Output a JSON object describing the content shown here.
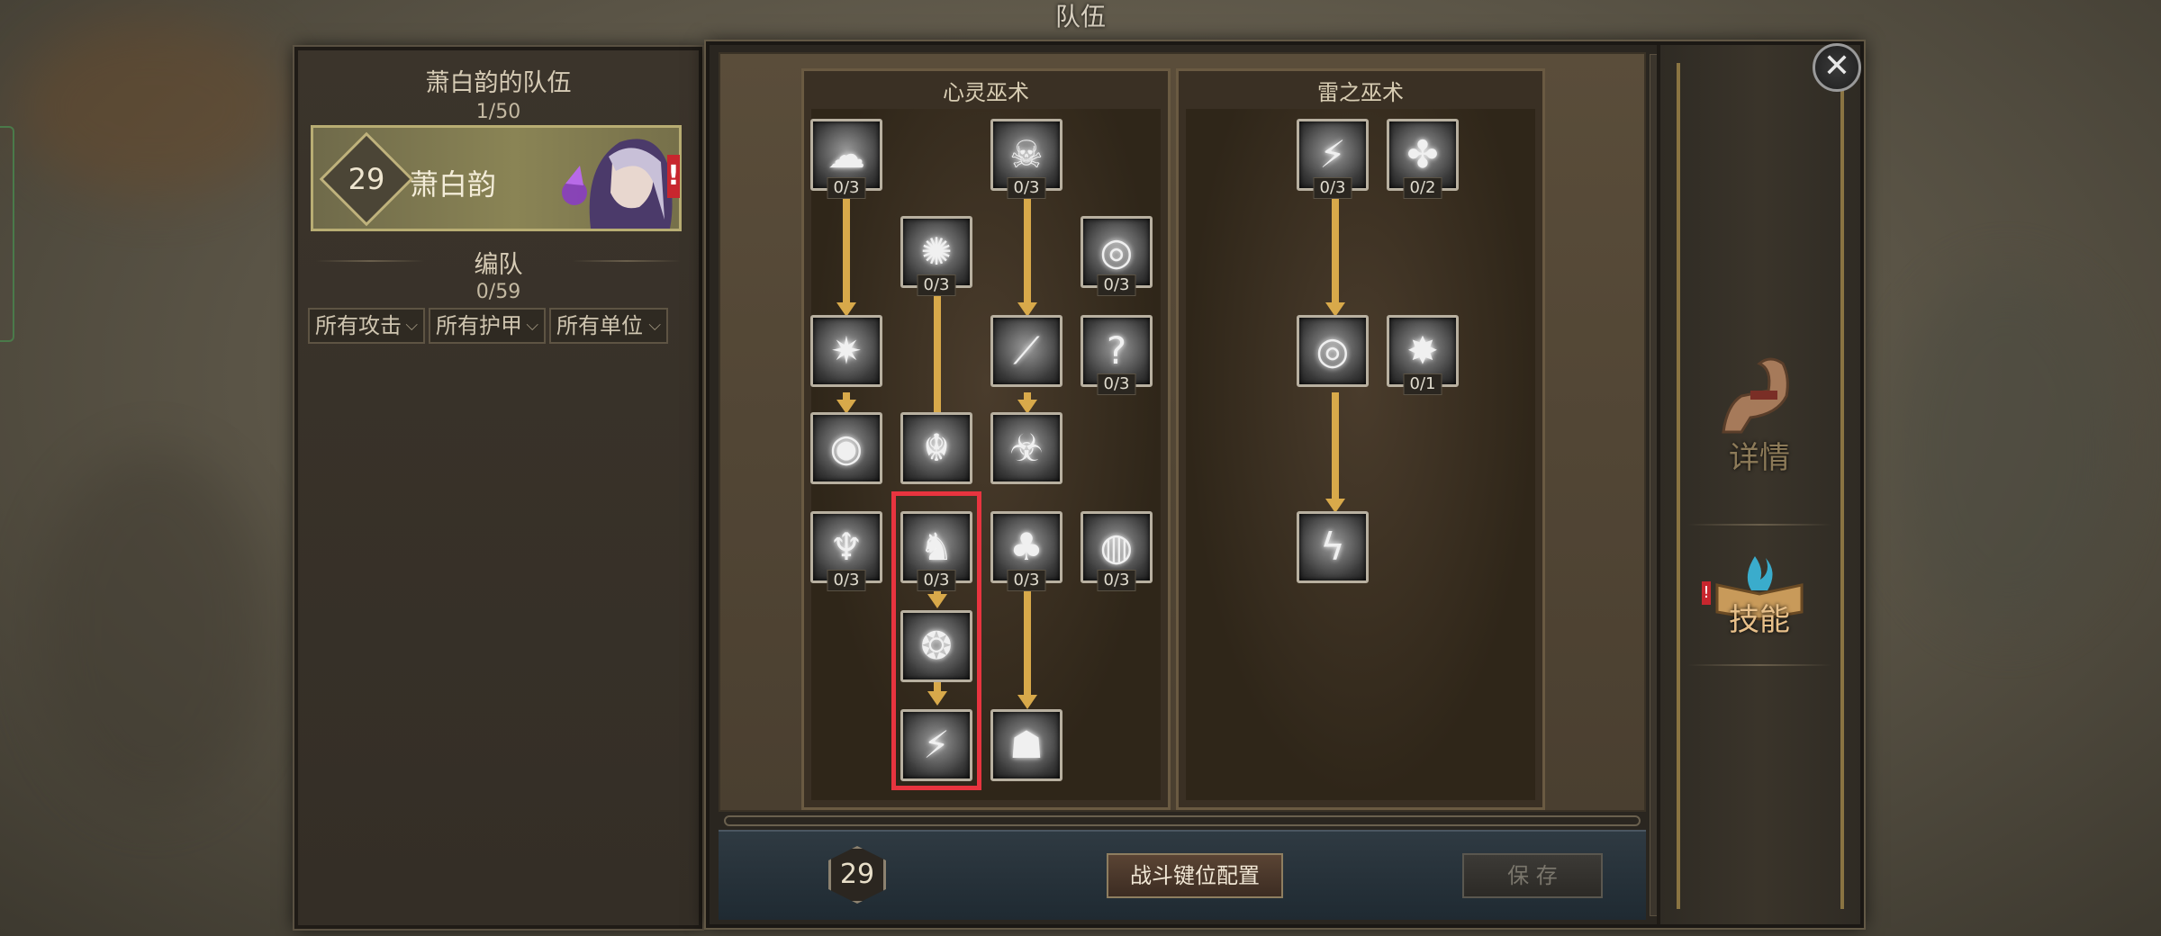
{
  "window": {
    "title": "队伍"
  },
  "left_panel": {
    "team_title": "萧白韵的队伍",
    "team_count": "1/50",
    "hero": {
      "level": "29",
      "name": "萧白韵",
      "alert": "!"
    },
    "formation_title": "编队",
    "formation_count": "0/59",
    "filters": [
      "所有攻击",
      "所有护甲",
      "所有单位"
    ]
  },
  "skill_trees": [
    {
      "name": "心灵巫术",
      "skills": [
        {
          "icon": "mist-swirl-icon",
          "glyph": "☁",
          "count": "0/3"
        },
        {
          "icon": "demon-mask-icon",
          "glyph": "☠",
          "count": "0/3"
        },
        {
          "icon": "radiant-burst-icon",
          "glyph": "✺",
          "count": "0/3"
        },
        {
          "icon": "vortex-icon",
          "glyph": "◎",
          "count": "0/3"
        },
        {
          "icon": "shatter-icon",
          "glyph": "✷",
          "count": ""
        },
        {
          "icon": "blade-slash-icon",
          "glyph": "⟋",
          "count": ""
        },
        {
          "icon": "question-runes-icon",
          "glyph": "?",
          "count": "0/3"
        },
        {
          "icon": "energy-orb-icon",
          "glyph": "◉",
          "count": ""
        },
        {
          "icon": "beetle-icon",
          "glyph": "☬",
          "count": ""
        },
        {
          "icon": "fanged-beast-icon",
          "glyph": "☣",
          "count": ""
        },
        {
          "icon": "ghost-icon",
          "glyph": "♆",
          "count": "0/3"
        },
        {
          "icon": "wraith-icon",
          "glyph": "♞",
          "count": "0/3"
        },
        {
          "icon": "dark-tree-icon",
          "glyph": "♣",
          "count": "0/3"
        },
        {
          "icon": "spiral-eye-icon",
          "glyph": "◍",
          "count": "0/3"
        },
        {
          "icon": "thorn-ring-icon",
          "glyph": "❂",
          "count": ""
        },
        {
          "icon": "lightning-shards-icon",
          "glyph": "⚡",
          "count": ""
        },
        {
          "icon": "hooded-figure-icon",
          "glyph": "☗",
          "count": ""
        }
      ]
    },
    {
      "name": "雷之巫术",
      "skills": [
        {
          "icon": "lightning-fist-icon",
          "glyph": "⚡",
          "count": "0/3"
        },
        {
          "icon": "shuriken-swirl-icon",
          "glyph": "✤",
          "count": "0/2"
        },
        {
          "icon": "spiral-storm-icon",
          "glyph": "◎",
          "count": ""
        },
        {
          "icon": "thunder-burst-icon",
          "glyph": "✸",
          "count": "0/1"
        },
        {
          "icon": "chain-lightning-icon",
          "glyph": "ϟ",
          "count": ""
        }
      ]
    }
  ],
  "bottom_bar": {
    "level": "29",
    "hotkey_button": "战斗键位配置",
    "save_button": "保 存"
  },
  "side_tabs": [
    {
      "label": "详情",
      "icon": "flexing-arm-icon",
      "color": "#8c7a58"
    },
    {
      "label": "技能",
      "icon": "spellbook-icon",
      "color": "#e8c08a",
      "alert": "!"
    }
  ],
  "colors": {
    "highlight": "#e8343f",
    "arrow": "#d8a94a",
    "alert": "#d8343a"
  }
}
